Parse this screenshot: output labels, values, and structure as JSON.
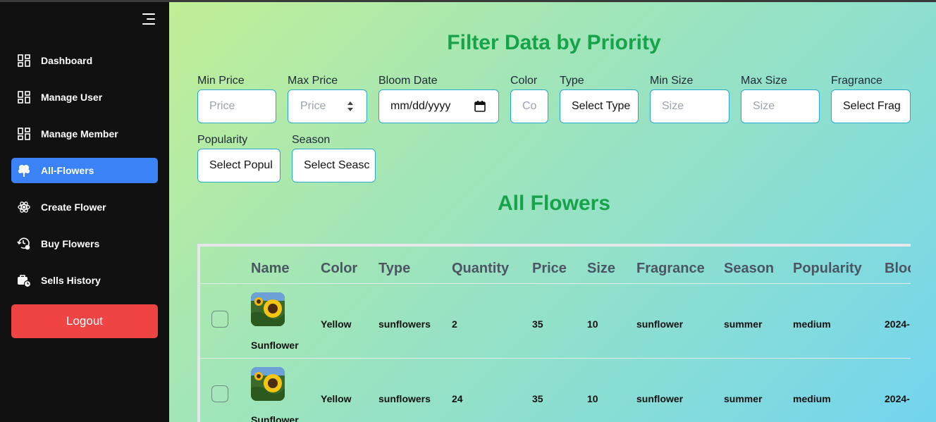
{
  "sidebar": {
    "items": [
      {
        "label": "Dashboard",
        "icon": "dashboard-grid-icon"
      },
      {
        "label": "Manage User",
        "icon": "dashboard-grid-icon"
      },
      {
        "label": "Manage Member",
        "icon": "dashboard-grid-icon"
      },
      {
        "label": "All-Flowers",
        "icon": "flower-icon",
        "active": true
      },
      {
        "label": "Create Flower",
        "icon": "atom-icon"
      },
      {
        "label": "Buy Flowers",
        "icon": "history-gear-icon"
      },
      {
        "label": "Sells History",
        "icon": "briefcase-clock-icon"
      }
    ],
    "logout_label": "Logout"
  },
  "filter": {
    "title": "Filter Data by Priority",
    "fields": {
      "min_price": {
        "label": "Min Price",
        "placeholder": "Price"
      },
      "max_price": {
        "label": "Max Price",
        "placeholder": "Price"
      },
      "bloom_date": {
        "label": "Bloom Date",
        "value": "mm/dd/yyyy"
      },
      "color": {
        "label": "Color",
        "placeholder": "Co"
      },
      "type": {
        "label": "Type",
        "value": "Select Type"
      },
      "min_size": {
        "label": "Min Size",
        "placeholder": "Size"
      },
      "max_size": {
        "label": "Max Size",
        "placeholder": "Size"
      },
      "fragrance": {
        "label": "Fragrance",
        "value": "Select Frag"
      },
      "popularity": {
        "label": "Popularity",
        "value": "Select Popul"
      },
      "season": {
        "label": "Season",
        "value": "Select Seasc"
      }
    }
  },
  "table": {
    "title": "All Flowers",
    "headers": [
      "Name",
      "Color",
      "Type",
      "Quantity",
      "Price",
      "Size",
      "Fragrance",
      "Season",
      "Popularity",
      "Bloo"
    ],
    "rows": [
      {
        "name": "Sunflower",
        "color": "Yellow",
        "type": "sunflowers",
        "quantity": "2",
        "price": "35",
        "size": "10",
        "fragrance": "sunflower",
        "season": "summer",
        "popularity": "medium",
        "bloom": "2024-"
      },
      {
        "name": "Sunflower",
        "color": "Yellow",
        "type": "sunflowers",
        "quantity": "24",
        "price": "35",
        "size": "10",
        "fragrance": "sunflower",
        "season": "summer",
        "popularity": "medium",
        "bloom": "2024-"
      }
    ]
  },
  "colors": {
    "sidebar_bg": "#111111",
    "active_nav": "#3b82f6",
    "logout": "#ef4444",
    "heading_green": "#16a34a",
    "input_border": "#2aa9cf"
  }
}
